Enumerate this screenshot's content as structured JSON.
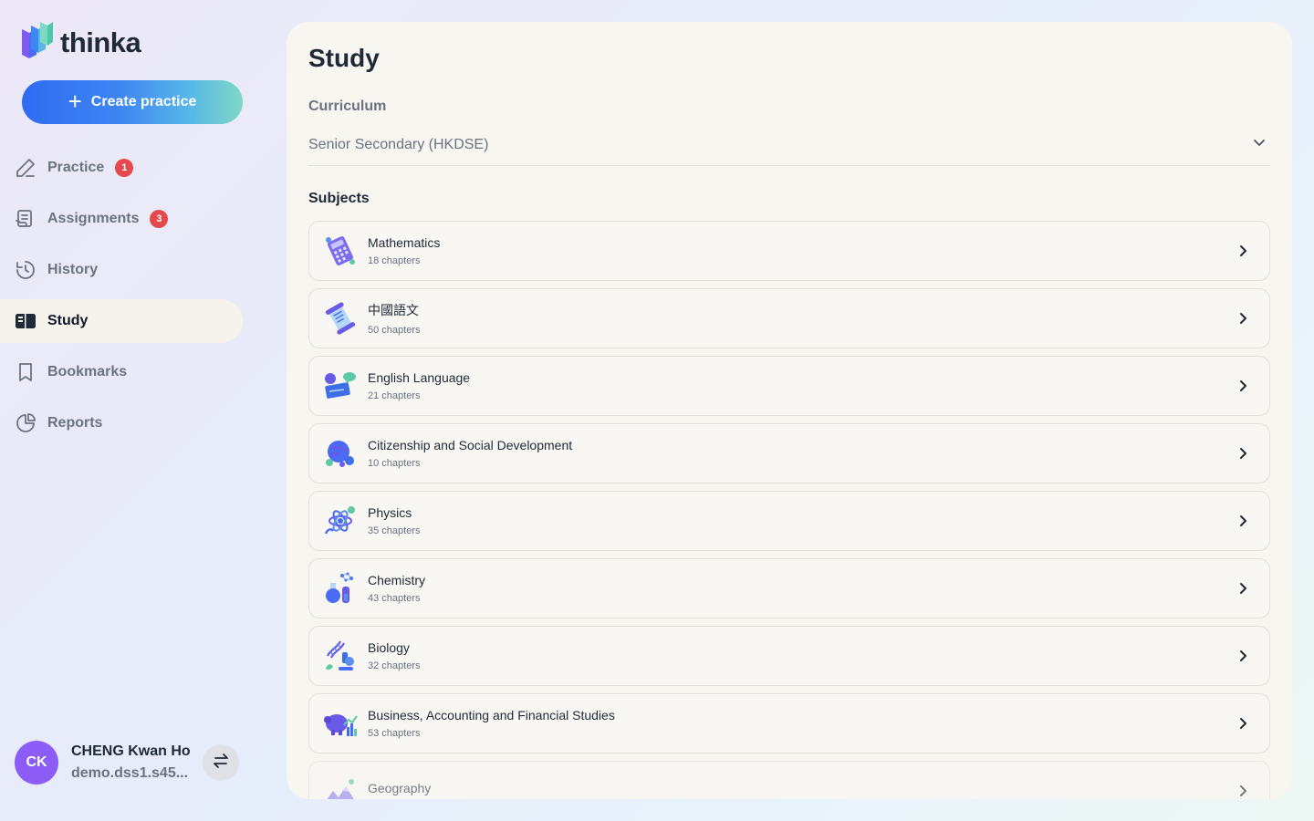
{
  "app": {
    "name": "thinka"
  },
  "sidebar": {
    "create_button": "Create practice",
    "items": [
      {
        "label": "Practice",
        "badge": "1",
        "icon": "pencil-icon"
      },
      {
        "label": "Assignments",
        "badge": "3",
        "icon": "assignment-icon"
      },
      {
        "label": "History",
        "badge": null,
        "icon": "history-icon"
      },
      {
        "label": "Study",
        "badge": null,
        "icon": "book-icon",
        "active": true
      },
      {
        "label": "Bookmarks",
        "badge": null,
        "icon": "bookmark-icon"
      },
      {
        "label": "Reports",
        "badge": null,
        "icon": "pie-chart-icon"
      }
    ]
  },
  "user": {
    "initials": "CK",
    "name": "CHENG Kwan Ho",
    "email": "demo.dss1.s45..."
  },
  "main": {
    "title": "Study",
    "curriculum_label": "Curriculum",
    "curriculum_value": "Senior Secondary (HKDSE)",
    "subjects_label": "Subjects",
    "subjects": [
      {
        "name": "Mathematics",
        "chapters": "18 chapters",
        "icon": "calculator-icon"
      },
      {
        "name": "中國語文",
        "chapters": "50 chapters",
        "icon": "scroll-icon"
      },
      {
        "name": "English Language",
        "chapters": "21 chapters",
        "icon": "speech-bubbles-icon"
      },
      {
        "name": "Citizenship and Social Development",
        "chapters": "10 chapters",
        "icon": "globe-icon"
      },
      {
        "name": "Physics",
        "chapters": "35 chapters",
        "icon": "atom-icon"
      },
      {
        "name": "Chemistry",
        "chapters": "43 chapters",
        "icon": "flask-icon"
      },
      {
        "name": "Biology",
        "chapters": "32 chapters",
        "icon": "dna-icon"
      },
      {
        "name": "Business, Accounting and Financial Studies",
        "chapters": "53 chapters",
        "icon": "piggy-bank-icon"
      },
      {
        "name": "Geography",
        "chapters": "",
        "icon": "mountain-icon"
      }
    ]
  },
  "colors": {
    "accent": "#2f6bf3",
    "badge": "#e5484d",
    "avatar": "#8b5cf6"
  }
}
